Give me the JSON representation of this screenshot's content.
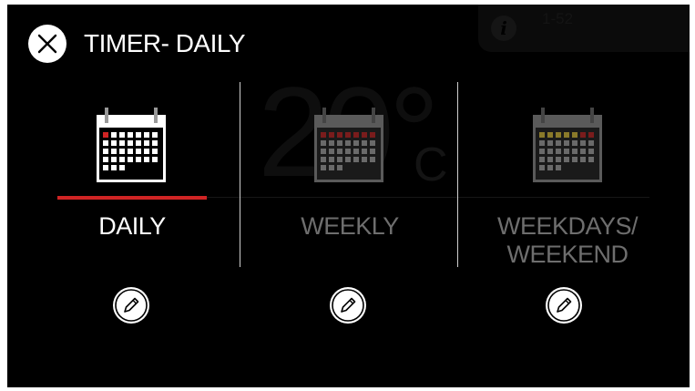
{
  "header": {
    "title": "TIMER- DAILY",
    "close_icon": "close-icon"
  },
  "background": {
    "info_icon_label": "i",
    "info_text": "1-52",
    "temperature": "20°",
    "unit": "C"
  },
  "options": [
    {
      "label": "DAILY",
      "icon": "calendar-icon",
      "selected": true,
      "edit_icon": "pencil-icon"
    },
    {
      "label": "WEEKLY",
      "icon": "calendar-icon",
      "selected": false,
      "edit_icon": "pencil-icon"
    },
    {
      "label_line1": "WEEKDAYS/",
      "label_line2": "WEEKEND",
      "icon": "calendar-icon",
      "selected": false,
      "edit_icon": "pencil-icon"
    }
  ],
  "colors": {
    "accent_red": "#d02424",
    "active_text": "#ffffff",
    "inactive_text": "#6e6e6e",
    "background": "#000000",
    "weekend_mark": "#8a7a2a"
  }
}
